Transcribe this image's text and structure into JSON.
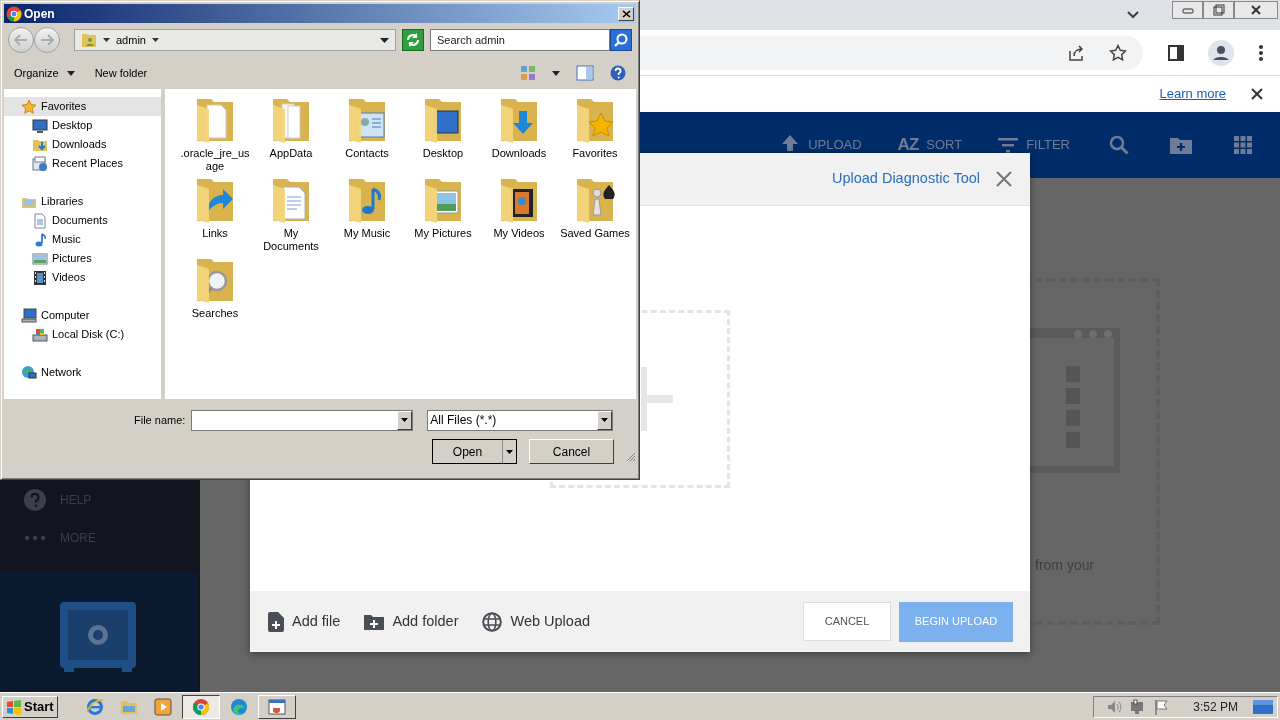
{
  "browser": {
    "infobar": {
      "link": "Learn more"
    }
  },
  "app": {
    "toolbar": [
      {
        "kind": "upload",
        "label": "UPLOAD"
      },
      {
        "kind": "sort",
        "glyph": "AZ",
        "label": "SORT"
      },
      {
        "kind": "filter",
        "label": "FILTER"
      },
      {
        "kind": "search"
      },
      {
        "kind": "new-folder"
      },
      {
        "kind": "grid"
      }
    ],
    "sidebar": [
      {
        "kind": "help",
        "label": "HELP"
      },
      {
        "kind": "more",
        "label": "MORE"
      }
    ],
    "page_hint": "from your",
    "modal": {
      "title": "Upload Diagnostic Tool",
      "actions": [
        {
          "kind": "file",
          "label": "Add file"
        },
        {
          "kind": "folder",
          "label": "Add folder"
        },
        {
          "kind": "web",
          "label": "Web Upload"
        }
      ],
      "buttons": [
        {
          "kind": "secondary",
          "label": "CANCEL",
          "disabled": false
        },
        {
          "kind": "primary",
          "label": "BEGIN UPLOAD",
          "disabled": true
        }
      ]
    }
  },
  "dialog": {
    "title": "Open",
    "location": "admin",
    "search": {
      "placeholder": "Search admin"
    },
    "toolbar": [
      {
        "kind": "menu",
        "label": "Organize"
      },
      {
        "kind": "button",
        "label": "New folder"
      }
    ],
    "nav": [
      {
        "kind": "favorites",
        "label": "Favorites",
        "selected": true,
        "children": [
          {
            "kind": "desktop",
            "label": "Desktop",
            "selected": false
          },
          {
            "kind": "downloads",
            "label": "Downloads",
            "selected": false
          },
          {
            "kind": "recent",
            "label": "Recent Places",
            "selected": false
          }
        ]
      },
      {
        "kind": "libraries",
        "label": "Libraries",
        "selected": false,
        "children": [
          {
            "kind": "documents",
            "label": "Documents",
            "selected": false
          },
          {
            "kind": "music",
            "label": "Music",
            "selected": false
          },
          {
            "kind": "pictures",
            "label": "Pictures",
            "selected": false
          },
          {
            "kind": "videos",
            "label": "Videos",
            "selected": false
          }
        ]
      },
      {
        "kind": "computer",
        "label": "Computer",
        "selected": false,
        "children": [
          {
            "kind": "disk",
            "label": "Local Disk (C:)",
            "selected": false
          }
        ]
      },
      {
        "kind": "network",
        "label": "Network",
        "selected": false
      }
    ],
    "files": [
      {
        "kind": "plain",
        "name": ".oracle_jre_usage"
      },
      {
        "kind": "appdata",
        "name": "AppData"
      },
      {
        "kind": "contacts",
        "name": "Contacts"
      },
      {
        "kind": "desktop",
        "name": "Desktop"
      },
      {
        "kind": "downloads",
        "name": "Downloads"
      },
      {
        "kind": "favorites",
        "name": "Favorites"
      },
      {
        "kind": "links",
        "name": "Links"
      },
      {
        "kind": "documents",
        "name": "My Documents"
      },
      {
        "kind": "music",
        "name": "My Music"
      },
      {
        "kind": "pictures",
        "name": "My Pictures"
      },
      {
        "kind": "videos",
        "name": "My Videos"
      },
      {
        "kind": "games",
        "name": "Saved Games"
      },
      {
        "kind": "searches",
        "name": "Searches"
      }
    ],
    "file_name_label": "File name:",
    "file_type": "All Files (*.*)",
    "buttons": [
      {
        "kind": "split",
        "label": "Open"
      },
      {
        "kind": "plain",
        "label": "Cancel"
      }
    ]
  },
  "taskbar": {
    "start": "Start",
    "apps": [
      {
        "kind": "ie",
        "running": false,
        "selected": false
      },
      {
        "kind": "explorer",
        "running": false,
        "selected": false
      },
      {
        "kind": "media",
        "running": false,
        "selected": false
      },
      {
        "kind": "chrome",
        "running": true,
        "selected": true
      },
      {
        "kind": "edge",
        "running": false,
        "selected": false
      },
      {
        "kind": "java",
        "running": true,
        "selected": false
      }
    ],
    "clock": "3:52 PM"
  }
}
